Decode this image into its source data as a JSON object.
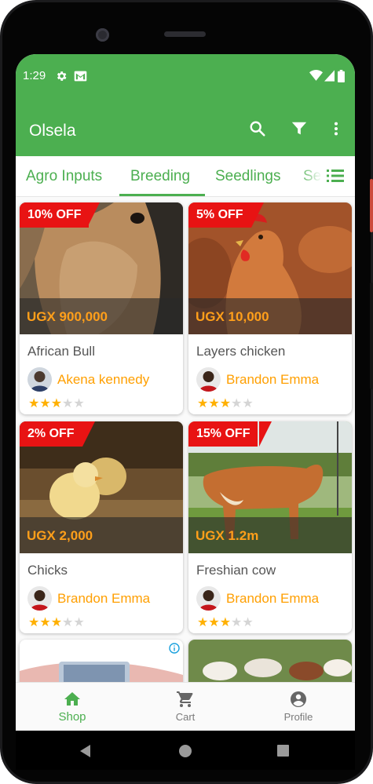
{
  "status_bar": {
    "time": "1:29"
  },
  "app_bar": {
    "title": "Olsela"
  },
  "tabs": [
    "Agro Inputs",
    "Breeding",
    "Seedlings",
    "Se"
  ],
  "products": [
    {
      "name": "African Bull",
      "price": "UGX 900,000",
      "discount": "10% OFF",
      "seller": "Akena kennedy",
      "rating": 3
    },
    {
      "name": "Layers chicken",
      "price": "UGX 10,000",
      "discount": "5% OFF",
      "seller": "Brandon Emma",
      "rating": 3
    },
    {
      "name": "Chicks",
      "price": "UGX 2,000",
      "discount": "2% OFF",
      "seller": "Brandon Emma",
      "rating": 3
    },
    {
      "name": "Freshian cow",
      "price": "UGX 1.2m",
      "discount": "15% OFF",
      "seller": "Brandon Emma",
      "rating": 3
    }
  ],
  "bottom_nav": [
    {
      "label": "Shop",
      "icon": "home-icon",
      "active": true
    },
    {
      "label": "Cart",
      "icon": "cart-icon",
      "active": false
    },
    {
      "label": "Profile",
      "icon": "profile-icon",
      "active": false
    }
  ],
  "colors": {
    "primary": "#4caf50",
    "discount": "#e81313",
    "price": "#ff9f1a",
    "seller": "#ff9f00",
    "star": "#ffb000"
  }
}
